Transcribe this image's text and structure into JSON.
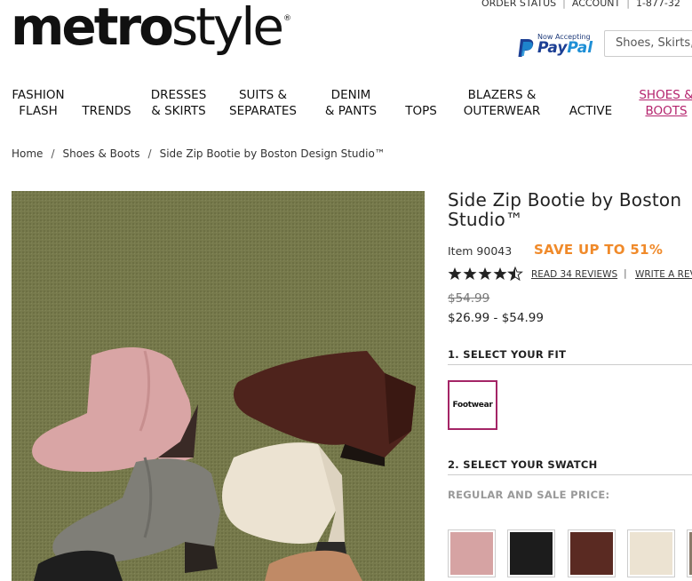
{
  "header": {
    "logo_main": "metro",
    "logo_rest": "style",
    "logo_mark": "®",
    "top_links": [
      "ORDER STATUS",
      "ACCOUNT",
      "1-877-32"
    ],
    "paypal_now": "Now Accepting",
    "paypal_pay": "Pay",
    "paypal_pal": "Pal",
    "search_placeholder": "Shoes, Skirts,"
  },
  "nav": [
    {
      "line1": "FASHION",
      "line2": "FLASH"
    },
    {
      "line1": "",
      "line2": "TRENDS"
    },
    {
      "line1": "DRESSES",
      "line2": "& SKIRTS"
    },
    {
      "line1": "SUITS &",
      "line2": "SEPARATES"
    },
    {
      "line1": "DENIM",
      "line2": "& PANTS"
    },
    {
      "line1": "",
      "line2": "TOPS"
    },
    {
      "line1": "BLAZERS &",
      "line2": "OUTERWEAR"
    },
    {
      "line1": "",
      "line2": "ACTIVE"
    },
    {
      "line1": "SHOES &",
      "line2": "BOOTS"
    }
  ],
  "breadcrumb": [
    "Home",
    "Shoes & Boots",
    "Side Zip Bootie by Boston Design Studio™"
  ],
  "product": {
    "title_line1": "Side Zip Bootie by Boston",
    "title_line2": "Studio™",
    "item": "Item 90043",
    "save": "SAVE UP TO 51%",
    "rating": 4.5,
    "reviews_link": "READ 34 REVIEWS",
    "write_link": "WRITE A REV",
    "old_price": "$54.99",
    "price": "$26.99 - $54.99",
    "fit_heading": "1. SELECT YOUR FIT",
    "fit_option": "Footwear",
    "swatch_heading": "2. SELECT YOUR SWATCH",
    "price_type": "REGULAR AND SALE PRICE:"
  },
  "colors": {
    "accent": "#b4236d",
    "save_orange": "#f08a2a",
    "swatches": [
      "#d6a3a3",
      "#1c1c1c",
      "#5a2a22",
      "#ece3d2",
      "#8a7a6a"
    ]
  }
}
